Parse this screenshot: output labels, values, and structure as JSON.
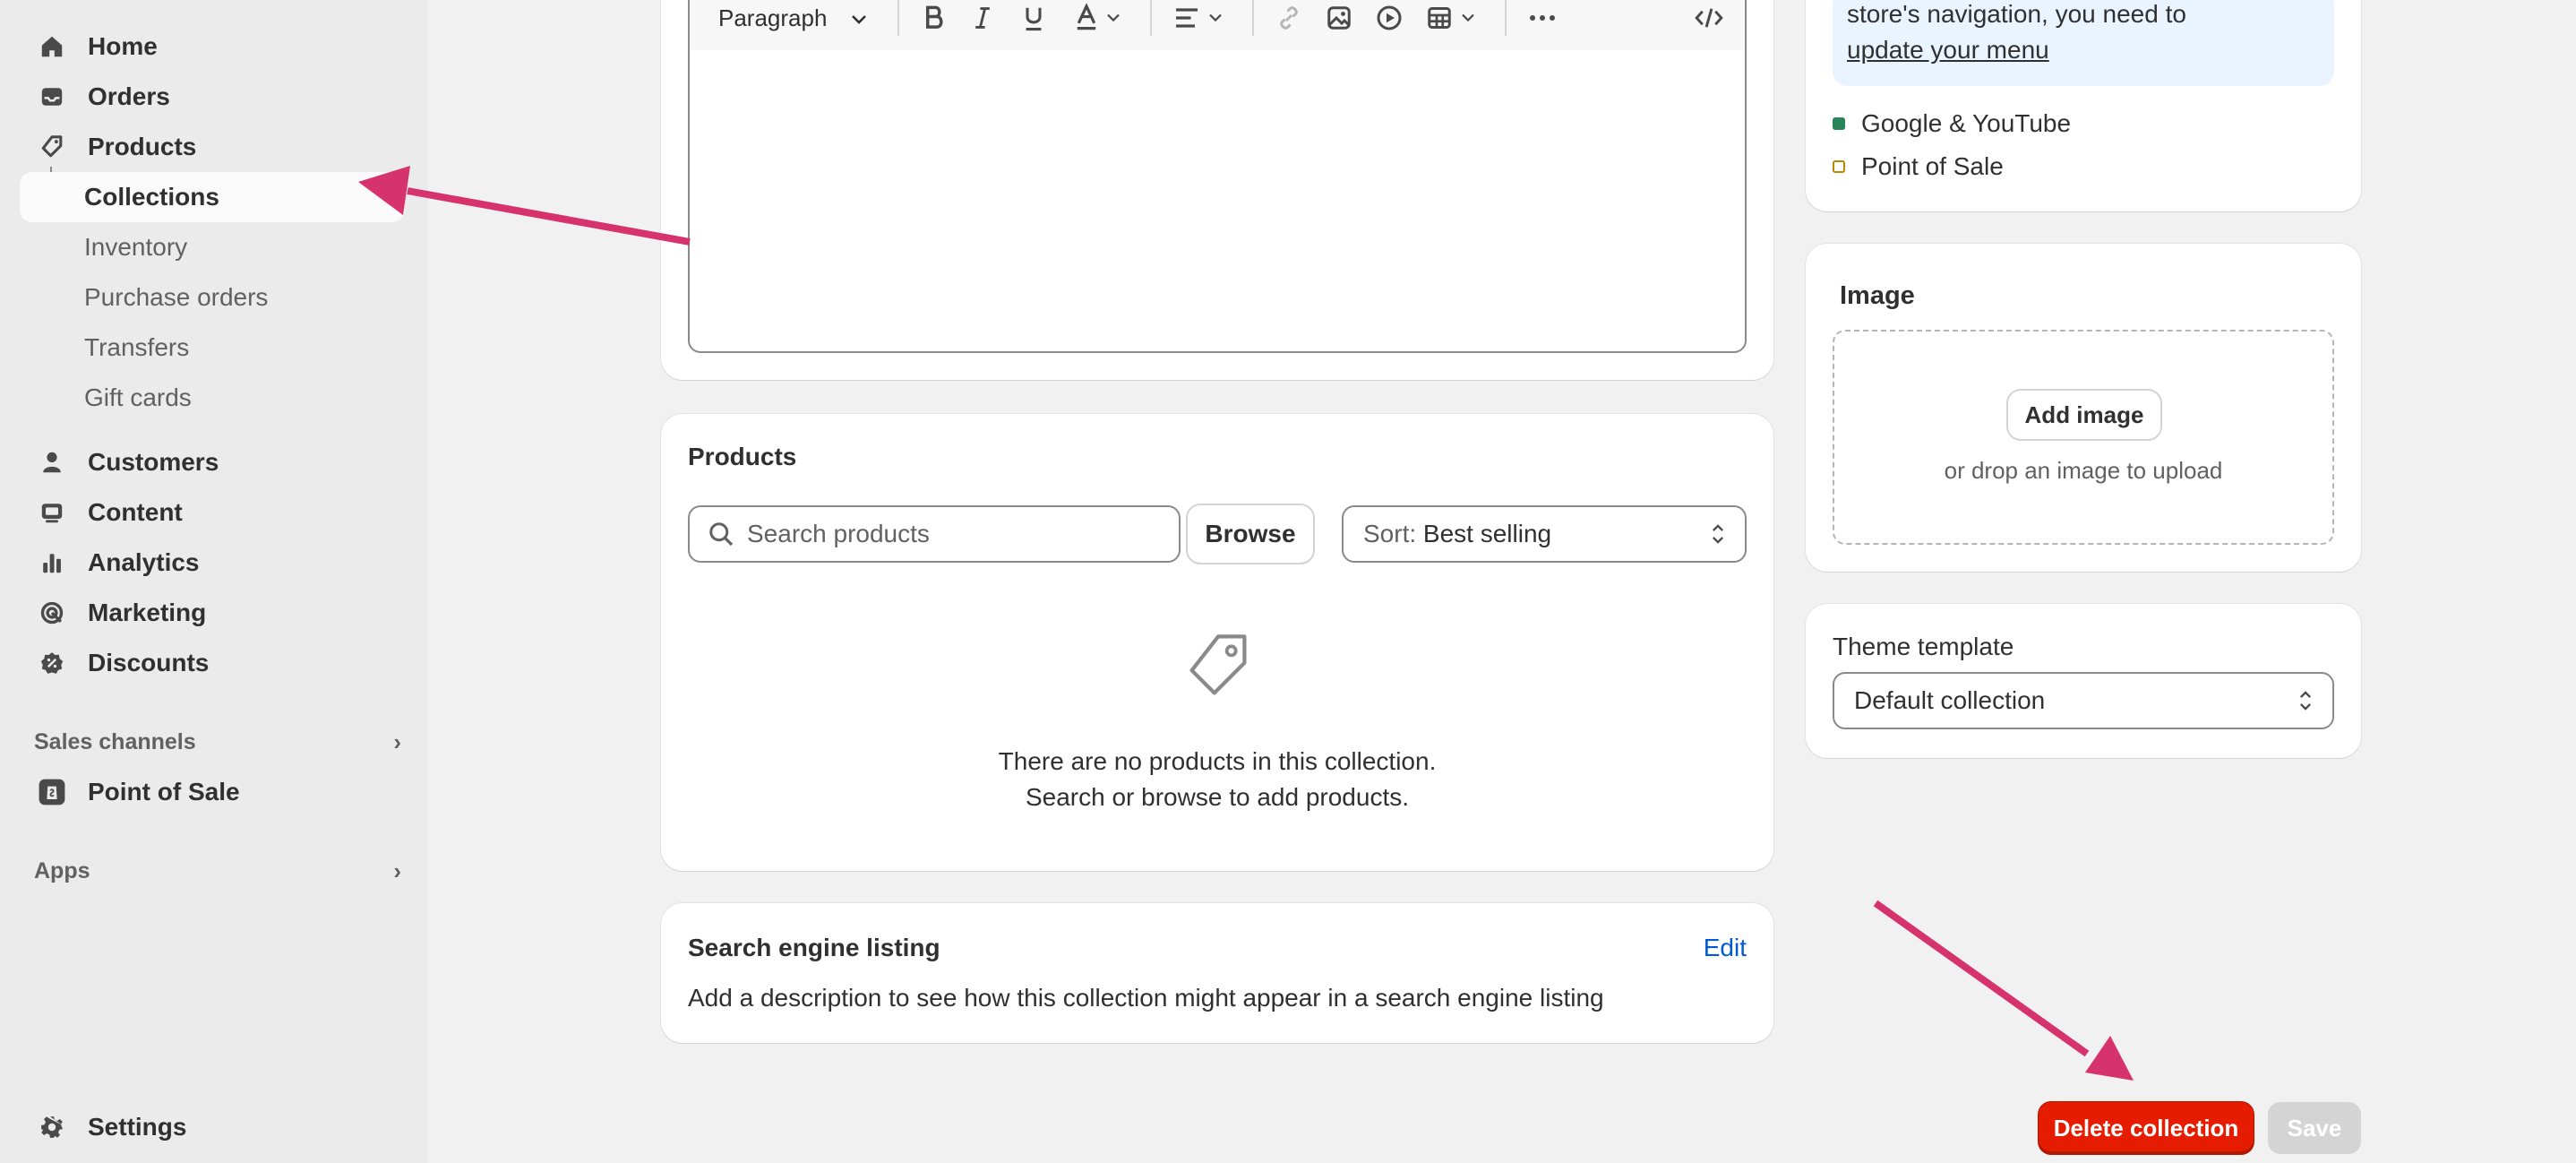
{
  "sidebar": {
    "items": [
      {
        "label": "Home",
        "icon": "home-icon"
      },
      {
        "label": "Orders",
        "icon": "orders-inbox-icon"
      },
      {
        "label": "Products",
        "icon": "tag-icon"
      }
    ],
    "sub_items": [
      {
        "label": "Collections"
      },
      {
        "label": "Inventory"
      },
      {
        "label": "Purchase orders"
      },
      {
        "label": "Transfers"
      },
      {
        "label": "Gift cards"
      }
    ],
    "items2": [
      {
        "label": "Customers",
        "icon": "person-icon"
      },
      {
        "label": "Content",
        "icon": "content-icon"
      },
      {
        "label": "Analytics",
        "icon": "bar-chart-icon"
      },
      {
        "label": "Marketing",
        "icon": "target-icon"
      },
      {
        "label": "Discounts",
        "icon": "discount-badge-icon"
      }
    ],
    "sales_channels_label": "Sales channels",
    "point_of_sale_label": "Point of Sale",
    "apps_label": "Apps",
    "settings_label": "Settings"
  },
  "editor": {
    "paragraph_label": "Paragraph"
  },
  "products_card": {
    "title": "Products",
    "search_placeholder": "Search products",
    "browse_label": "Browse",
    "sort_prefix": "Sort:",
    "sort_value": "Best selling",
    "empty_line1": "There are no products in this collection.",
    "empty_line2": "Search or browse to add products."
  },
  "seo_card": {
    "title": "Search engine listing",
    "edit_label": "Edit",
    "description": "Add a description to see how this collection might appear in a search engine listing"
  },
  "publishing": {
    "notice_text": "store's navigation, you need to",
    "notice_link": "update your menu",
    "channels": [
      {
        "label": "Google & YouTube",
        "status": "published"
      },
      {
        "label": "Point of Sale",
        "status": "unpublished"
      }
    ]
  },
  "image_card": {
    "title": "Image",
    "add_label": "Add image",
    "hint": "or drop an image to upload"
  },
  "theme_card": {
    "title": "Theme template",
    "value": "Default collection"
  },
  "footer": {
    "delete_label": "Delete collection",
    "save_label": "Save"
  },
  "colors": {
    "accent_arrow": "#d6336c",
    "danger": "#e51c00",
    "published_dot": "#29845a",
    "unpublished_dot": "#b98900",
    "link": "#005bd3"
  }
}
